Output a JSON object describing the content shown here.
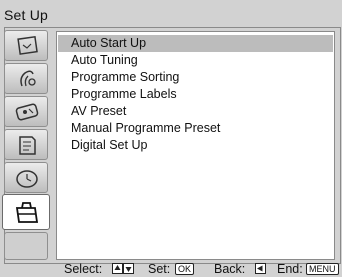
{
  "menu": {
    "title": "Set Up"
  },
  "sidebar": {
    "icons": [
      {
        "name": "picture-adjustment-icon"
      },
      {
        "name": "sound-adjustment-icon"
      },
      {
        "name": "features-icon"
      },
      {
        "name": "teletext-icon"
      },
      {
        "name": "timer-icon"
      },
      {
        "name": "set-up-toolbox-icon"
      }
    ],
    "active_index": 5
  },
  "list": {
    "items": [
      {
        "label": "Auto Start Up",
        "selected": true
      },
      {
        "label": "Auto  Tuning",
        "selected": false
      },
      {
        "label": "Programme  Sorting",
        "selected": false
      },
      {
        "label": "Programme  Labels",
        "selected": false
      },
      {
        "label": "AV  Preset",
        "selected": false
      },
      {
        "label": "Manual  Programme  Preset",
        "selected": false
      },
      {
        "label": "Digital Set Up",
        "selected": false
      }
    ]
  },
  "footer": {
    "select_label": "Select:",
    "set_label": "Set:",
    "set_key": "OK",
    "back_label": "Back:",
    "end_label": "End:",
    "end_key": "MENU"
  },
  "colors": {
    "background": "#d2d2d2",
    "list_background": "#ffffff",
    "highlight": "#bcbcbc"
  }
}
